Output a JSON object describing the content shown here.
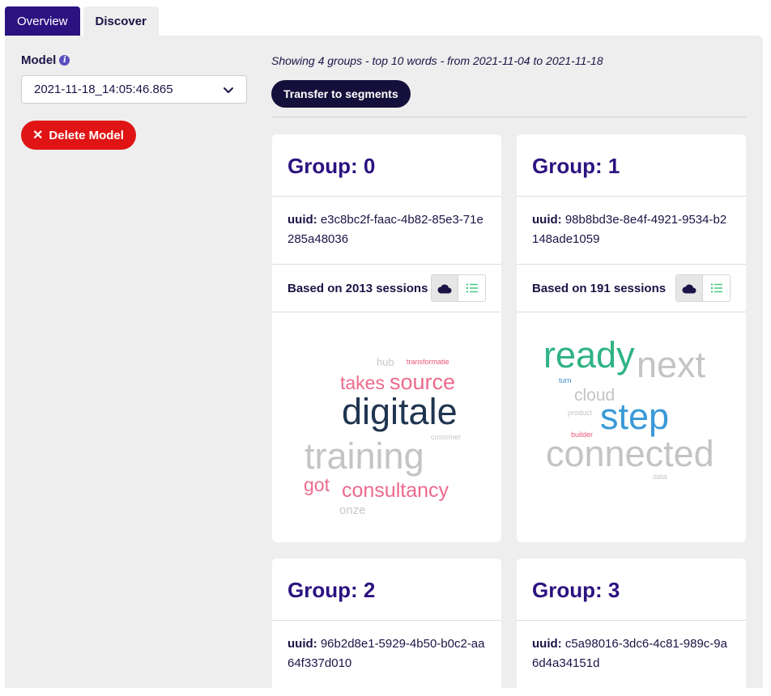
{
  "tabs": [
    {
      "label": "Overview",
      "active": true
    },
    {
      "label": "Discover",
      "active": false
    }
  ],
  "sidebar": {
    "model_label": "Model",
    "model_value": "2021-11-18_14:05:46.865",
    "delete_label": "Delete Model"
  },
  "main": {
    "showing_text": "Showing 4 groups - top 10 words - from 2021-11-04 to 2021-11-18",
    "transfer_label": "Transfer to segments"
  },
  "groups": [
    {
      "title": "Group: 0",
      "uuid_label": "uuid:",
      "uuid": "e3c8bc2f-faac-4b82-85e3-71e285a48036",
      "sessions": "Based on 2013 sessions",
      "words": [
        {
          "text": "hub",
          "color": "#c8c8c8"
        },
        {
          "text": "transformatie",
          "color": "#e8557a"
        },
        {
          "text": "takes",
          "color": "#ec6a8d"
        },
        {
          "text": "source",
          "color": "#ec6a8d"
        },
        {
          "text": "digitale",
          "color": "#1f3550"
        },
        {
          "text": "customer",
          "color": "#c8c8c8"
        },
        {
          "text": "training",
          "color": "#c4c4c4"
        },
        {
          "text": "got",
          "color": "#ec6a8d"
        },
        {
          "text": "consultancy",
          "color": "#ec6a8d"
        },
        {
          "text": "onze",
          "color": "#c8c8c8"
        }
      ]
    },
    {
      "title": "Group: 1",
      "uuid_label": "uuid:",
      "uuid": "98b8bd3e-8e4f-4921-9534-b2148ade1059",
      "sessions": "Based on 191 sessions",
      "words": [
        {
          "text": "ready",
          "color": "#2fb383"
        },
        {
          "text": "next",
          "color": "#c4c4c4"
        },
        {
          "text": "turn",
          "color": "#3a8fd0"
        },
        {
          "text": "cloud",
          "color": "#c4c4c4"
        },
        {
          "text": "product",
          "color": "#c4c4c4"
        },
        {
          "text": "step",
          "color": "#3a9ad8"
        },
        {
          "text": "builder",
          "color": "#e8557a"
        },
        {
          "text": "connected",
          "color": "#c4c4c4"
        },
        {
          "text": "data",
          "color": "#c4c4c4"
        }
      ]
    },
    {
      "title": "Group: 2",
      "uuid_label": "uuid:",
      "uuid": "96b2d8e1-5929-4b50-b0c2-aa64f337d010"
    },
    {
      "title": "Group: 3",
      "uuid_label": "uuid:",
      "uuid": "c5a98016-3dc6-4c81-989c-9a6d4a34151d"
    }
  ],
  "colors": {
    "accent": "#2b1280",
    "danger": "#e01414",
    "dark_button": "#15103b",
    "list_icon": "#3cc87a"
  },
  "icons": [
    "info-icon",
    "chevron-down-icon",
    "close-icon",
    "cloud-icon",
    "list-icon"
  ]
}
